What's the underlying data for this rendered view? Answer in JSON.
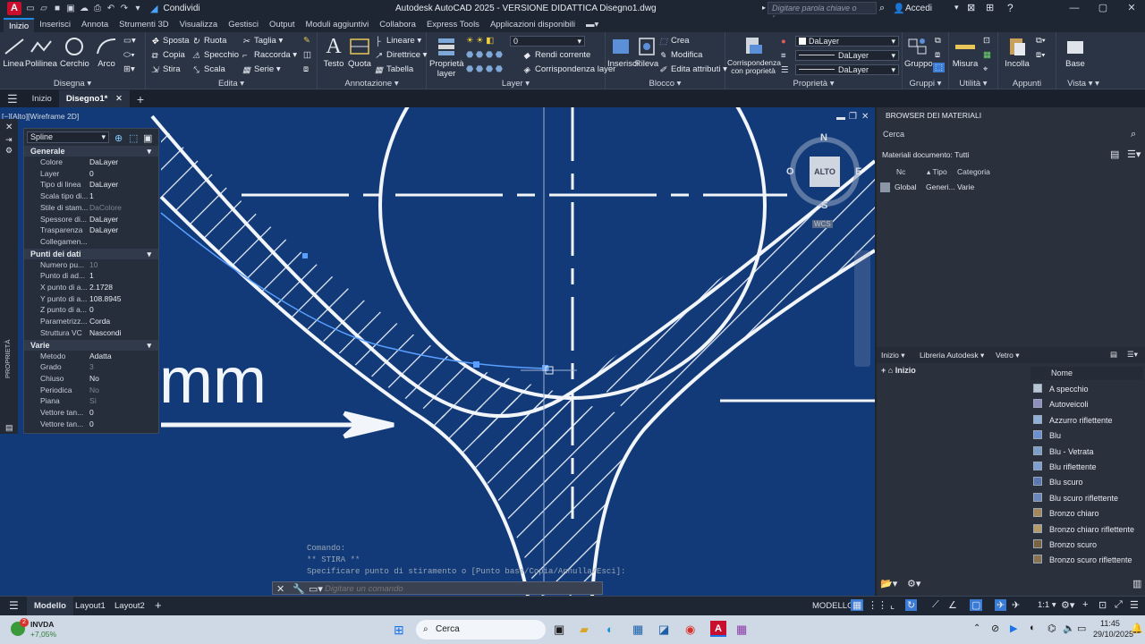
{
  "app": {
    "logo": "A",
    "title": "Autodesk AutoCAD 2025 - VERSIONE DIDATTICA    Disegno1.dwg",
    "share": "Condividi",
    "search_placeholder": "Digitare parola chiave o frase",
    "signin": "Accedi"
  },
  "ribbon_tabs": [
    "Inizio",
    "Inserisci",
    "Annota",
    "Strumenti 3D",
    "Visualizza",
    "Gestisci",
    "Output",
    "Moduli aggiuntivi",
    "Collabora",
    "Express Tools",
    "Applicazioni disponibili"
  ],
  "ribbon": {
    "draw": {
      "label": "Disegna",
      "line": "Linea",
      "polyline": "Polilinea",
      "circle": "Cerchio",
      "arc": "Arco"
    },
    "edit": {
      "label": "Edita",
      "move": "Sposta",
      "rotate": "Ruota",
      "trim": "Taglia",
      "copy": "Copia",
      "mirror": "Specchio",
      "fillet": "Raccorda",
      "stretch": "Stira",
      "scale": "Scala",
      "array": "Serie"
    },
    "annotation": {
      "label": "Annotazione",
      "text": "Testo",
      "dimension": "Quota",
      "linear": "Lineare",
      "leader": "Direttrice",
      "table": "Tabella"
    },
    "layers": {
      "label": "Layer",
      "properties": "Proprietà layer",
      "current": "0",
      "make_current": "Rendi corrente",
      "match": "Corrispondenza layer"
    },
    "block": {
      "label": "Blocco",
      "insert": "Inserisci",
      "edit": "Rileva",
      "create": "Crea",
      "modify": "Modifica",
      "attributes": "Edita attributi"
    },
    "properties": {
      "label": "Proprietà",
      "match": "Corrispondenza con proprietà",
      "color": "DaLayer",
      "linetype": "DaLayer",
      "lineweight": "DaLayer"
    },
    "groups": {
      "label": "Gruppi",
      "group": "Gruppo"
    },
    "utilities": {
      "label": "Utilità",
      "measure": "Misura"
    },
    "clipboard": {
      "label": "Appunti",
      "paste": "Incolla"
    },
    "view": {
      "label": "Vista",
      "base": "Base"
    }
  },
  "doc_tabs": [
    "Inizio",
    "Disegno1*"
  ],
  "viewport": {
    "label": "[−][Alto][Wireframe 2D]",
    "viewcube": {
      "top": "ALTO",
      "n": "N",
      "s": "S",
      "e": "E",
      "w": "O",
      "wcs": "WCS"
    },
    "drawing_text": "mm"
  },
  "properties_palette": {
    "selected": "Spline",
    "side_label": "PROPRIETÀ",
    "sections": [
      {
        "title": "Generale",
        "rows": [
          [
            "Colore",
            "DaLayer"
          ],
          [
            "Layer",
            "0"
          ],
          [
            "Tipo di linea",
            "DaLayer"
          ],
          [
            "Scala tipo di...",
            "1"
          ],
          [
            "Stile di stam...",
            "DaColore"
          ],
          [
            "Spessore di...",
            "DaLayer"
          ],
          [
            "Trasparenza",
            "DaLayer"
          ],
          [
            "Collegamen...",
            ""
          ]
        ]
      },
      {
        "title": "Punti dei dati",
        "rows": [
          [
            "Numero pu...",
            "10"
          ],
          [
            "Punto di ad...",
            "1"
          ],
          [
            "X punto di a...",
            "2.1728"
          ],
          [
            "Y punto di a...",
            "108.8945"
          ],
          [
            "Z punto di a...",
            "0"
          ],
          [
            "Parametrizz...",
            "Corda"
          ],
          [
            "Struttura VC",
            "Nascondi"
          ]
        ]
      },
      {
        "title": "Varie",
        "rows": [
          [
            "Metodo",
            "Adatta"
          ],
          [
            "Grado",
            "3"
          ],
          [
            "Chiuso",
            "No"
          ],
          [
            "Periodica",
            "No"
          ],
          [
            "Piana",
            "Sì"
          ],
          [
            "Vettore tan...",
            "0"
          ],
          [
            "Vettore tan...",
            "0"
          ]
        ]
      }
    ]
  },
  "material_browser": {
    "title": "BROWSER DEI MATERIALI",
    "search": "Cerca",
    "doc_materials": "Materiali documento: Tutti",
    "cols": [
      "Nc",
      "Tipo",
      "Categoria"
    ],
    "doc_row": [
      "Global",
      "Generi...",
      "Varie"
    ],
    "lib_nav": [
      "Inizio",
      "Libreria Autodesk",
      "Vetro"
    ],
    "tree": "Inizio",
    "list_header": "Nome",
    "items": [
      "A specchio",
      "Autoveicoli",
      "Azzurro riflettente",
      "Blu",
      "Blu - Vetrata",
      "Blu riflettente",
      "Blu scuro",
      "Blu scuro riflettente",
      "Bronzo chiaro",
      "Bronzo chiaro riflettente",
      "Bronzo scuro",
      "Bronzo scuro riflettente"
    ],
    "item_colors": [
      "#b7c7d8",
      "#8f8fbf",
      "#8fb0d8",
      "#6d8fcf",
      "#7da0c8",
      "#7e9fd0",
      "#5b77b2",
      "#6a86ba",
      "#a5895a",
      "#b59a6a",
      "#7a6340",
      "#8a7350"
    ]
  },
  "command": {
    "history": [
      "Comando:",
      "** STIRA **",
      "Specificare punto di stiramento o [Punto base/Copia/Annulla/Esci]:"
    ],
    "placeholder": "Digitare un comando"
  },
  "status": {
    "tabs": [
      "Modello",
      "Layout1",
      "Layout2"
    ],
    "mode": "MODELLO",
    "scale": "1:1"
  },
  "taskbar": {
    "stock": "INVDA",
    "change": "+7,05%",
    "badge": "2",
    "search": "Cerca",
    "time": "11:45",
    "date": "29/10/2025"
  }
}
